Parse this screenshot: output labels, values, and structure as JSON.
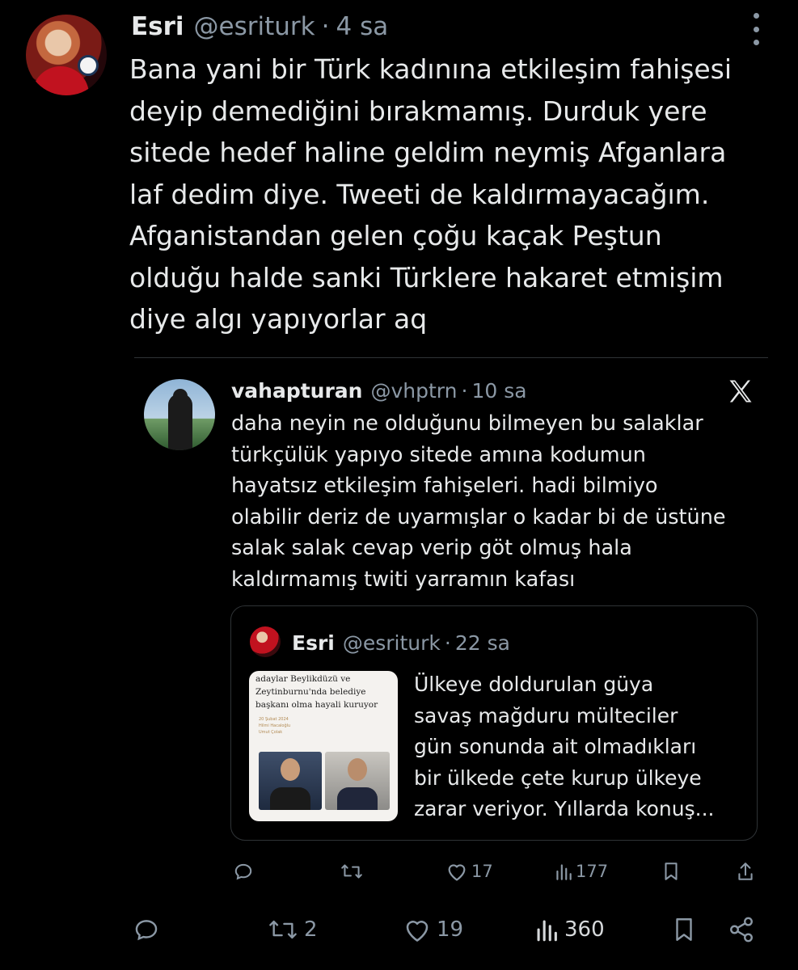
{
  "tweet": {
    "author_name": "Esri",
    "handle": "@esriturk",
    "separator": "·",
    "time": "4 sa",
    "text": "Bana yani bir Türk kadınına etkileşim fahişesi\ndeyip demediğini bırakmamış. Durduk yere\nsitede hedef haline geldim neymiş Afganlara\nlaf dedim diye. Tweeti de kaldırmayacağım.\nAfganistandan gelen çoğu kaçak Peştun\nolduğu halde sanki Türklere hakaret etmişim\ndiye algı yapıyorlar aq",
    "actions": {
      "replies": "",
      "retweets": "2",
      "likes": "19",
      "views": "360"
    }
  },
  "quoted": {
    "author_name": "vahapturan",
    "handle": "@vhptrn",
    "separator": "·",
    "time": "10 sa",
    "text": "daha neyin ne olduğunu bilmeyen bu salaklar\ntürkçülük yapıyo sitede amına kodumun\nhayatsız etkileşim fahişeleri. hadi bilmiyo\nolabilir deriz de uyarmışlar o kadar bi de üstüne\nsalak salak cevap verip göt olmuş hala\nkaldırmamış twiti yarramın kafası",
    "actions": {
      "replies": "",
      "retweets": "",
      "likes": "17",
      "views": "177"
    }
  },
  "inner": {
    "author_name": "Esri",
    "handle": "@esriturk",
    "separator": "·",
    "time": "22 sa",
    "text": "Ülkeye doldurulan güya\nsavaş mağduru mülteciler\ngün sonunda ait olmadıkları\nbir ülkede çete kurup ülkeye\nzarar veriyor. Yıllarda konuş...",
    "thumbnail": {
      "headline": "adaylar Beylikdüzü ve\nZeytinburnu'nda belediye\nbaşkanı olma hayali kuruyor",
      "date": "20 Şubat 2024",
      "authors": "Hilmi Hacaloğlu\nUmut Çolak"
    }
  },
  "icons": {
    "more": "more-icon",
    "x_logo": "x-logo-icon",
    "reply": "reply-icon",
    "retweet": "retweet-icon",
    "like": "heart-icon",
    "views": "views-icon",
    "bookmark": "bookmark-icon",
    "share": "share-icon"
  },
  "colors": {
    "background": "#000000",
    "text": "#e7e9ea",
    "muted": "#8b98a5",
    "border": "#2f3336"
  }
}
